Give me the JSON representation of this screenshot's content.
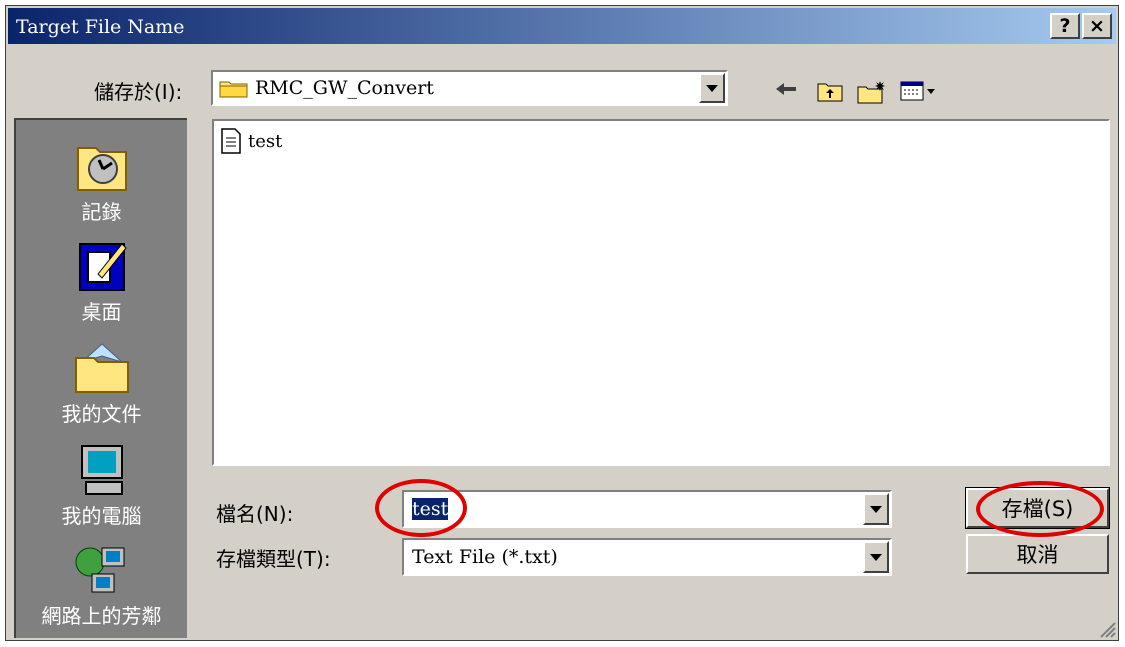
{
  "dialog": {
    "title": "Target File Name",
    "help_label": "?",
    "close_label": "×"
  },
  "save_in": {
    "label": "儲存於(I):",
    "value": "RMC_GW_Convert"
  },
  "places": [
    {
      "label": "記錄",
      "icon": "history-icon"
    },
    {
      "label": "桌面",
      "icon": "desktop-icon"
    },
    {
      "label": "我的文件",
      "icon": "my-documents-icon"
    },
    {
      "label": "我的電腦",
      "icon": "my-computer-icon"
    },
    {
      "label": "網路上的芳鄰",
      "icon": "network-places-icon"
    }
  ],
  "files": [
    {
      "name": "test",
      "icon": "text-file-icon"
    }
  ],
  "filename": {
    "label": "檔名(N):",
    "value": "test"
  },
  "filetype": {
    "label": "存檔類型(T):",
    "value": "Text File (*.txt)"
  },
  "buttons": {
    "save": "存檔(S)",
    "cancel": "取消"
  },
  "colors": {
    "title_start": "#0a246a",
    "title_end": "#a6caf0",
    "annotation": "#e00000",
    "dialog_bg": "#d4d0c8"
  }
}
